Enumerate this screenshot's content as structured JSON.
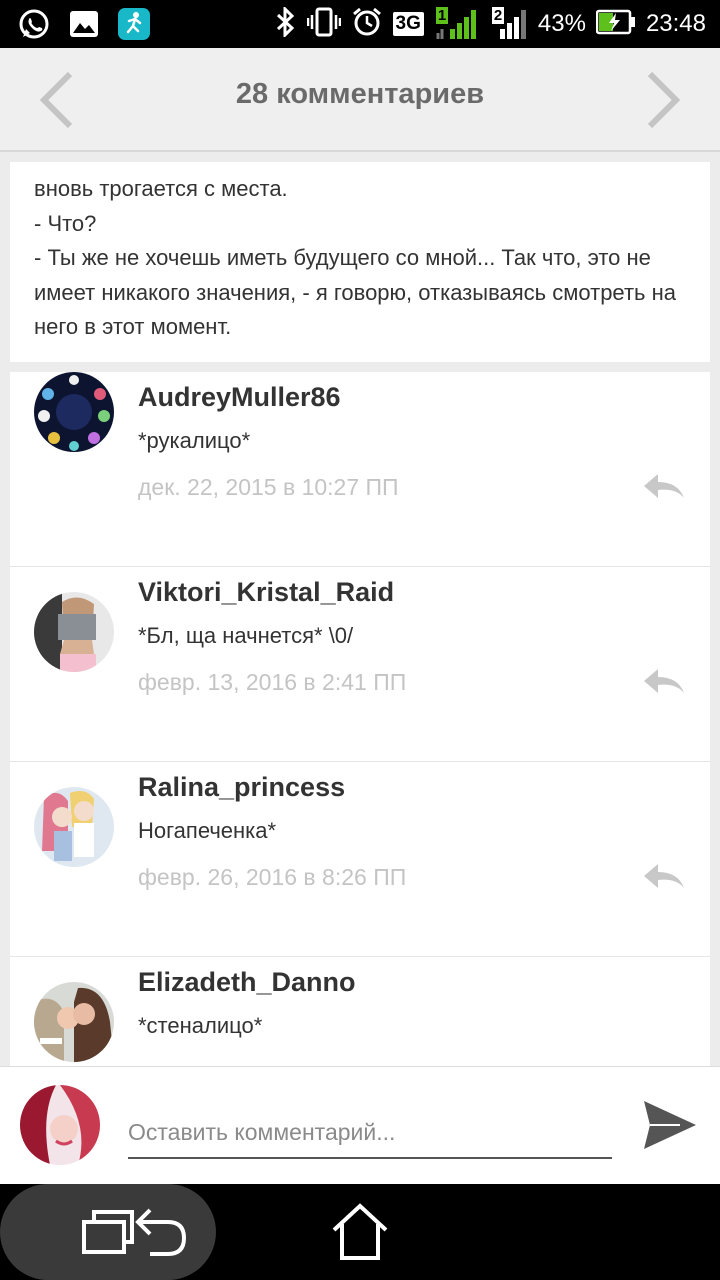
{
  "status_bar": {
    "network": "3G",
    "sim1": "1",
    "sim2": "2",
    "battery": "43%",
    "time": "23:48",
    "icons": [
      "whatsapp-icon",
      "gallery-icon",
      "fitness-app-icon",
      "bluetooth-icon",
      "vibrate-icon",
      "alarm-icon",
      "signal-icon",
      "battery-charging-icon"
    ]
  },
  "header": {
    "title": "28 комментариев"
  },
  "story": {
    "lines": [
      "вновь трогается с места.",
      "- Что?",
      "- Ты же не хочешь иметь будущего со мной... Так что, это не имеет никакого значения, - я говорю, отказываясь смотреть на него в этот момент."
    ]
  },
  "comments": [
    {
      "author": "AudreyMuller86",
      "text": "*рукалицо*",
      "date": "дек. 22, 2015 в 10:27 ПП"
    },
    {
      "author": "Viktori_Kristal_Raid",
      "text": "*Бл, ща начнется* \\0/",
      "date": "февр. 13, 2016 в 2:41 ПП"
    },
    {
      "author": "Ralina_princess",
      "text": "Ногапеченка*",
      "date": "февр. 26, 2016 в 8:26 ПП"
    },
    {
      "author": "Elizadeth_Danno",
      "text": "*стеналицо*",
      "date": ""
    }
  ],
  "compose": {
    "placeholder": "Оставить комментарий..."
  },
  "colors": {
    "header_bg": "#efefef",
    "title": "#6a6a6a",
    "date": "#c4c4c4",
    "text": "#333333"
  }
}
